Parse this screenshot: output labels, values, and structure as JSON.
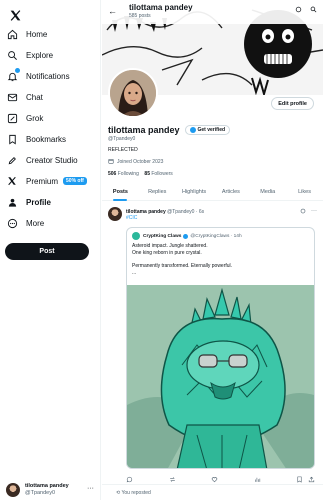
{
  "sidebar": {
    "items": [
      {
        "label": "Home",
        "icon": "home-icon"
      },
      {
        "label": "Explore",
        "icon": "search-icon"
      },
      {
        "label": "Notifications",
        "icon": "bell-icon"
      },
      {
        "label": "Chat",
        "icon": "mail-icon"
      },
      {
        "label": "Grok",
        "icon": "grok-icon"
      },
      {
        "label": "Bookmarks",
        "icon": "bookmark-icon"
      },
      {
        "label": "Creator Studio",
        "icon": "rocket-icon"
      },
      {
        "label": "Premium",
        "icon": "x-logo-icon",
        "badge": "50% off"
      },
      {
        "label": "Profile",
        "icon": "person-icon"
      },
      {
        "label": "More",
        "icon": "more-circle-icon"
      }
    ],
    "post_label": "Post",
    "account": {
      "name": "tilottama pandey",
      "handle": "@Tpandey0",
      "more": "···"
    }
  },
  "header": {
    "title": "tilottama pandey",
    "subtitle": "585 posts",
    "back": "←"
  },
  "profile": {
    "edit_label": "Edit profile",
    "name": "tilottama pandey",
    "verified_label": "Get verified",
    "handle": "@Tpandey0",
    "bio": "REFLECTED",
    "joined": "Joined October 2023",
    "following_count": "506",
    "following_label": "Following",
    "followers_count": "85",
    "followers_label": "Followers"
  },
  "tabs": [
    "Posts",
    "Replies",
    "Highlights",
    "Articles",
    "Media",
    "Likes"
  ],
  "tweet": {
    "name": "tilottama pandey",
    "meta": "@Tpandey0 · 6s",
    "tag": "#CIC",
    "quote": {
      "name": "CryptKing Claws",
      "meta": "@CryptKingClaws · 14h",
      "lines": [
        "Asteroid impact. Jungle shattered.",
        "One king reborn in pure crystal.",
        "",
        "Permanently transformed. Eternally powerful.",
        "..."
      ]
    }
  },
  "reposted_label": "You reposted",
  "colors": {
    "accent": "#1d9bf0",
    "text": "#0f1419",
    "muted": "#536471",
    "crystal": "#2bb89b"
  }
}
